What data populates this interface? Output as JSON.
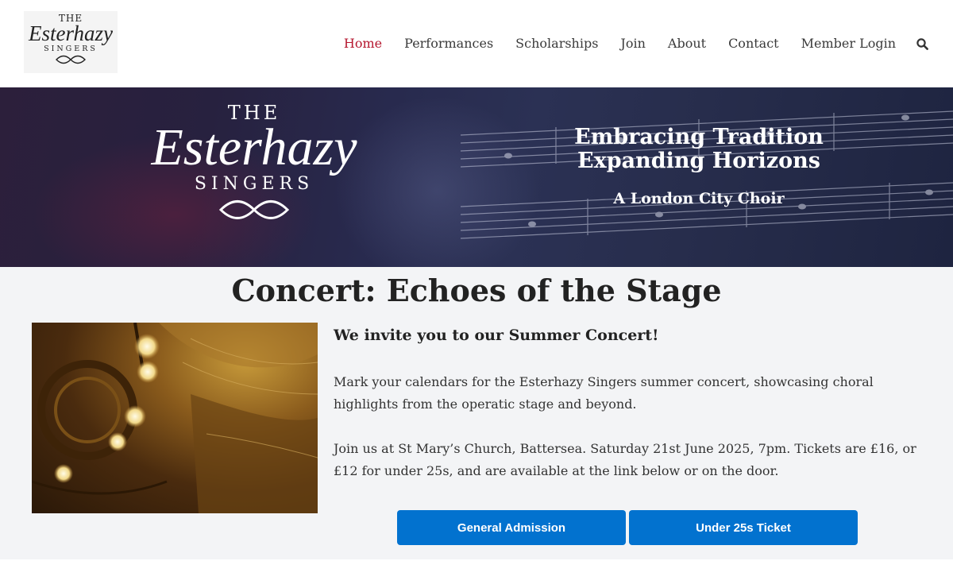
{
  "header": {
    "logo": {
      "the": "THE",
      "name": "Esterhazy",
      "singers": "SINGERS"
    },
    "nav": [
      {
        "label": "Home",
        "active": true
      },
      {
        "label": "Performances"
      },
      {
        "label": "Scholarships"
      },
      {
        "label": "Join"
      },
      {
        "label": "About"
      },
      {
        "label": "Contact"
      },
      {
        "label": "Member Login"
      }
    ],
    "search_icon": "search-icon",
    "active_color": "#b5172f"
  },
  "banner": {
    "logo": {
      "the": "THE",
      "name": "Esterhazy",
      "singers": "SINGERS"
    },
    "tagline_line1": "Embracing Tradition",
    "tagline_line2": "Expanding Horizons",
    "subtitle": "A London City Choir"
  },
  "main": {
    "title": "Concert: Echoes of the Stage",
    "invite": "We invite you to our Summer Concert!",
    "paragraph1": "Mark your calendars for the Esterhazy Singers summer concert, showcasing choral highlights from the operatic stage and beyond.",
    "paragraph2": "Join us at St Mary’s Church, Battersea. Saturday 21st June 2025, 7pm. Tickets are £16, or £12 for under 25s, and are available at the link below or on the door.",
    "buttons": {
      "general": "General Admission",
      "under25": "Under 25s Ticket"
    },
    "button_color": "#0272cf"
  }
}
